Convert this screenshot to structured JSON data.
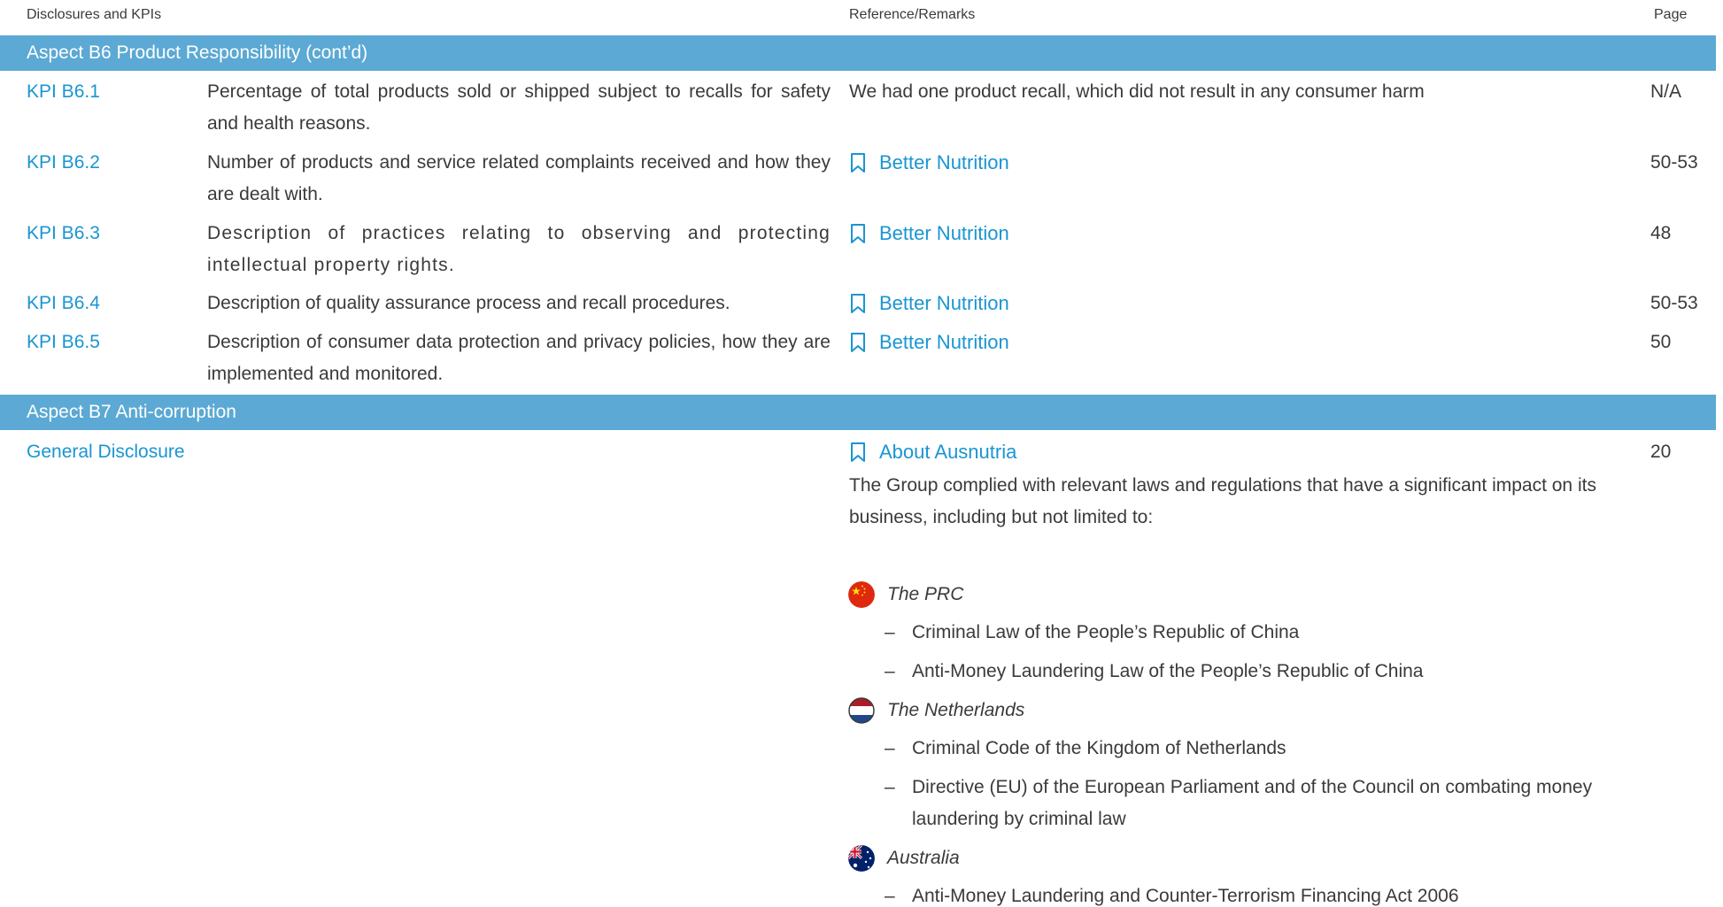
{
  "header": {
    "col_disclosures": "Disclosures and KPIs",
    "col_reference": "Reference/Remarks",
    "col_page": "Page"
  },
  "aspect_b6": {
    "title": "Aspect B6 Product Responsibility (cont’d)",
    "rows": [
      {
        "kpi": "KPI B6.1",
        "description": "Percentage of total products sold or shipped subject to recalls for safety and health reasons.",
        "reference": "We had one product recall, which did not result in any consumer harm",
        "page": "N/A"
      },
      {
        "kpi": "KPI B6.2",
        "description": "Number of products and service related complaints received and how they are dealt with.",
        "reference": "Better Nutrition",
        "page": "50-53"
      },
      {
        "kpi": "KPI B6.3",
        "description": "Description of practices relating to observing and protecting intellectual property rights.",
        "reference": "Better Nutrition",
        "page": "48"
      },
      {
        "kpi": "KPI B6.4",
        "description": "Description of quality assurance process and recall procedures.",
        "reference": "Better Nutrition",
        "page": "50-53"
      },
      {
        "kpi": "KPI B6.5",
        "description": "Description of consumer data protection and privacy policies, how they are implemented and monitored.",
        "reference": "Better Nutrition",
        "page": "50"
      }
    ]
  },
  "aspect_b7": {
    "title": "Aspect B7 Anti-corruption",
    "general_disclosure": {
      "label": "General Disclosure",
      "reference": "About Ausnutria",
      "page": "20",
      "intro": "The Group complied with relevant laws and regulations that have a significant impact on its business, including but not limited to:",
      "jurisdictions": [
        {
          "name": "The PRC",
          "flag_icon": "china-flag-icon",
          "laws": [
            "Criminal Law of the People’s Republic of China",
            "Anti-Money Laundering Law of the People’s Republic of China"
          ]
        },
        {
          "name": "The Netherlands",
          "flag_icon": "netherlands-flag-icon",
          "laws": [
            "Criminal Code of the Kingdom of Netherlands",
            "Directive (EU) of the European Parliament and of the Council on combating money laundering by criminal law"
          ]
        },
        {
          "name": "Australia",
          "flag_icon": "australia-flag-icon",
          "laws": [
            "Anti-Money Laundering and Counter-Terrorism Financing Act 2006"
          ]
        }
      ]
    }
  },
  "icons": {
    "reference_link": "bookmark-icon",
    "law_bullet": "–"
  },
  "colors": {
    "band": "#5ba9d4",
    "link": "#1a95d2",
    "text": "#3a3a3a"
  }
}
